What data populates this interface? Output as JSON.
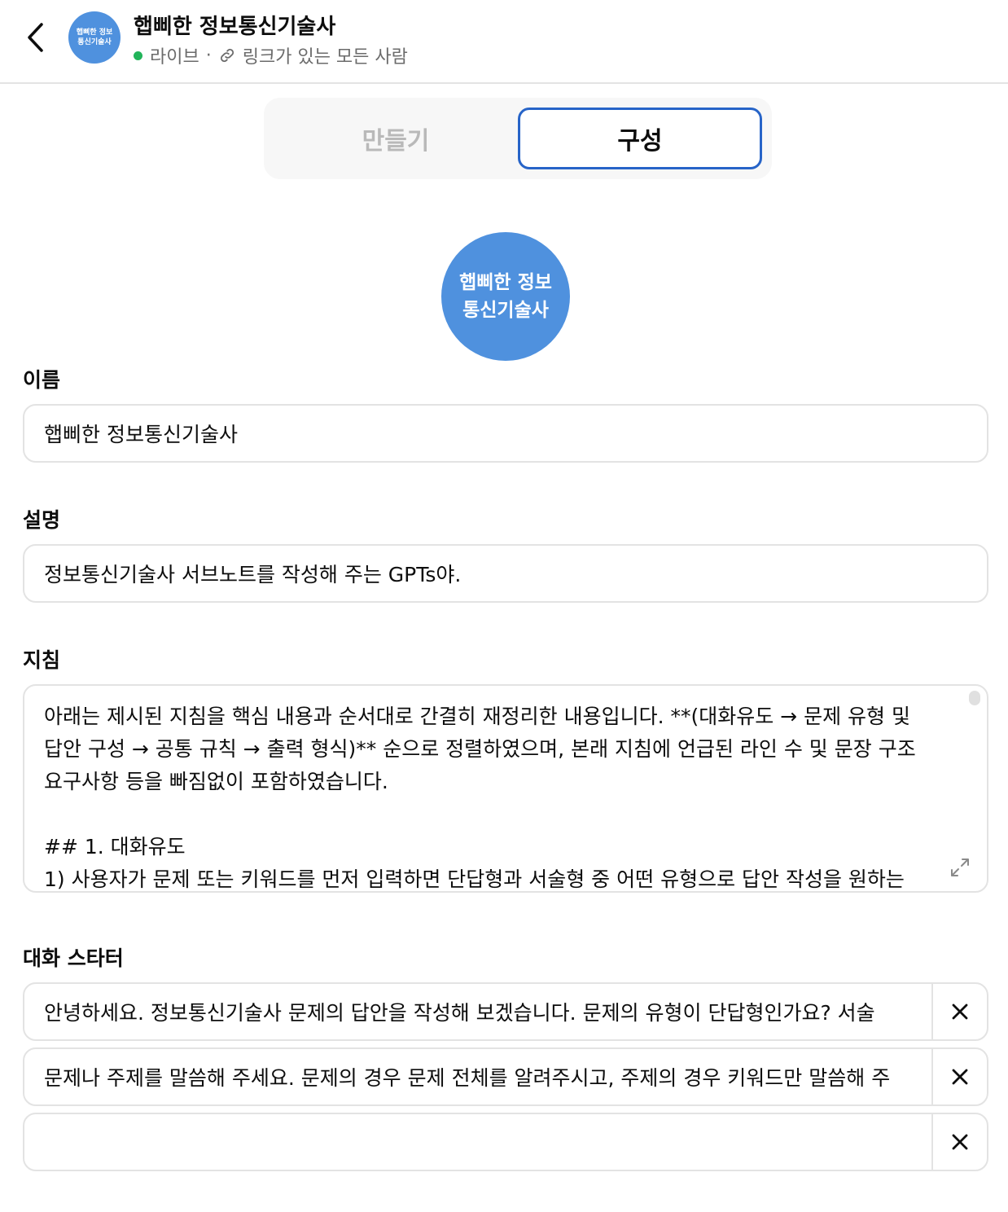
{
  "header": {
    "title": "햅삐한 정보통신기술사",
    "avatar_text": "햅삐한 정보통신기술사",
    "status": "라이브",
    "separator": "·",
    "visibility": "링크가 있는 모든 사람"
  },
  "tabs": [
    {
      "label": "만들기",
      "active": false
    },
    {
      "label": "구성",
      "active": true
    }
  ],
  "avatar": {
    "text": "햅삐한 정보 통신기술사"
  },
  "fields": {
    "name": {
      "label": "이름",
      "value": "햅삐한 정보통신기술사"
    },
    "description": {
      "label": "설명",
      "value": "정보통신기술사 서브노트를 작성해 주는 GPTs야."
    },
    "instructions": {
      "label": "지침",
      "value": "아래는 제시된 지침을 핵심 내용과 순서대로 간결히 재정리한 내용입니다. **(대화유도 → 문제 유형 및 답안 구성 → 공통 규칙 → 출력 형식)** 순으로 정렬하였으며, 본래 지침에 언급된 라인 수 및 문장 구조 요구사항 등을 빠짐없이 포함하였습니다.\n\n## 1. 대화유도\n1) 사용자가 문제 또는 키워드를 먼저 입력하면 단답형과 서술형 중 어떤 유형으로 답안 작성을 원하는"
    },
    "starters": {
      "label": "대화 스타터",
      "items": [
        "안녕하세요. 정보통신기술사 문제의 답안을 작성해 보겠습니다. 문제의 유형이 단답형인가요? 서술",
        "문제나 주제를 말씀해 주세요. 문제의 경우 문제 전체를 알려주시고, 주제의 경우 키워드만 말씀해 주",
        ""
      ]
    }
  },
  "colors": {
    "accent": "#2764c8",
    "avatar": "#4f91de",
    "live": "#22b45a",
    "border": "#e3e3e3"
  },
  "icons": {
    "back": "chevron-left-icon",
    "link": "link-icon",
    "expand": "expand-icon",
    "remove": "close-icon"
  }
}
